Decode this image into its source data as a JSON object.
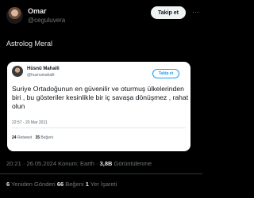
{
  "author": {
    "name": "Omar",
    "handle": "@ceguluvera",
    "follow_label": "Takip et",
    "more_label": "···"
  },
  "post": {
    "text": "Astrolog Meral"
  },
  "quoted": {
    "name": "Hüsnü Mahalli",
    "handle": "@husnumahalli",
    "follow_label": "Takip et",
    "text": "Suriye Ortadoğunun en güvenilir ve oturmuş ülkelerinden biri , bu gösteriler kesinlikle bir iç savaşa dönüşmez , rahat olun",
    "time": "22:57 - 20 Mar 2011",
    "retweets_count": "24",
    "retweets_label": "Retweet",
    "likes_count": "35",
    "likes_label": "Beğeni"
  },
  "meta": {
    "time": "20:21",
    "sep": " · ",
    "date": "26.05.2024",
    "location": " Konum: Earth · ",
    "views_count": "3,8B",
    "views_label": " Görüntülenme"
  },
  "stats": {
    "reposts_count": "6",
    "reposts_label": " Yeniden Gönderi ",
    "likes_count": "66",
    "likes_label": " Beğeni ",
    "bookmarks_count": "1",
    "bookmarks_label": " Yer İşareti"
  }
}
